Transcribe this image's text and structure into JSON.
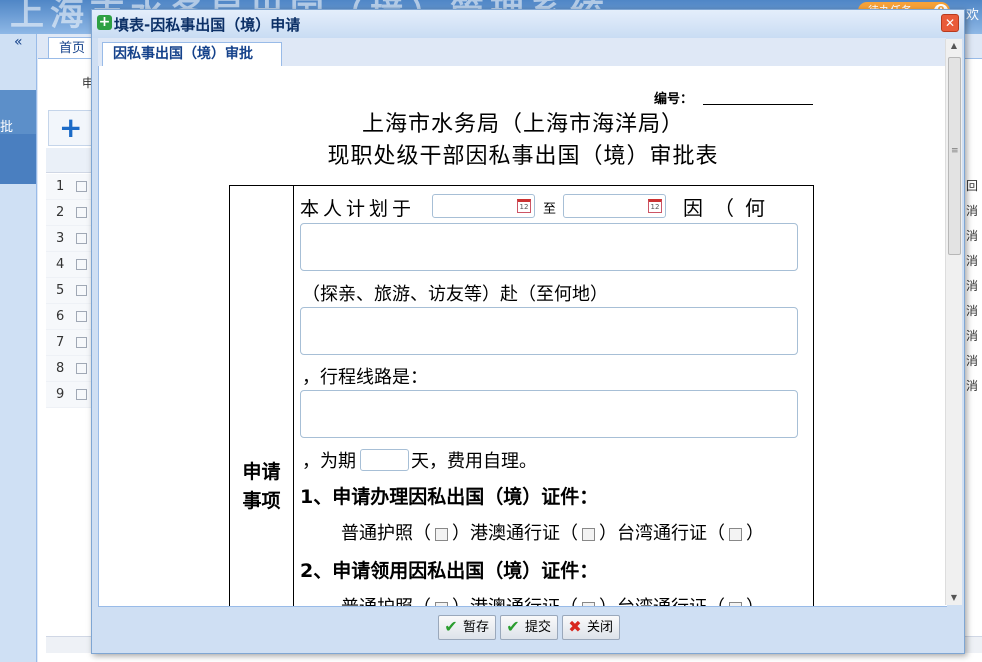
{
  "background_app": {
    "system_title": "上海市水务局出国（境）管理系统",
    "task_label": "待办任务",
    "task_count": "0",
    "welcome_text": "欢",
    "home_tab": "首页",
    "active_nav_label": "批",
    "column_header_fragment": "申",
    "row_numbers": [
      "1",
      "2",
      "3",
      "4",
      "5",
      "6",
      "7",
      "8",
      "9"
    ],
    "right_column_values": [
      "回",
      "消",
      "消",
      "消",
      "消",
      "消",
      "消",
      "消",
      "消"
    ]
  },
  "dialog": {
    "title": "填表-因私事出国（境）申请",
    "tab_label": "因私事出国（境）审批",
    "serial_label": "编号：",
    "org_title": "上海市水务局（上海市海洋局）",
    "form_title": "现职处级干部因私事出国（境）审批表",
    "section_label": "申请\n事项",
    "plan_prefix": "本人计划于",
    "date_to": "至",
    "because": "因（何事）",
    "purpose_hint": "（探亲、旅游、访友等）赴（至何地）",
    "route_label": "，行程线路是：",
    "period_prefix": "，为期",
    "period_suffix": "天，费用自理。",
    "section1": "1、申请办理因私出国（境）证件：",
    "section2": "2、申请领用因私出国（境）证件：",
    "doc_passport": "普通护照（",
    "doc_hk_macau": "）港澳通行证（",
    "doc_taiwan": "）台湾通行证（",
    "doc_close": "）",
    "buttons": {
      "save": "暂存",
      "submit": "提交",
      "close": "关闭"
    }
  }
}
